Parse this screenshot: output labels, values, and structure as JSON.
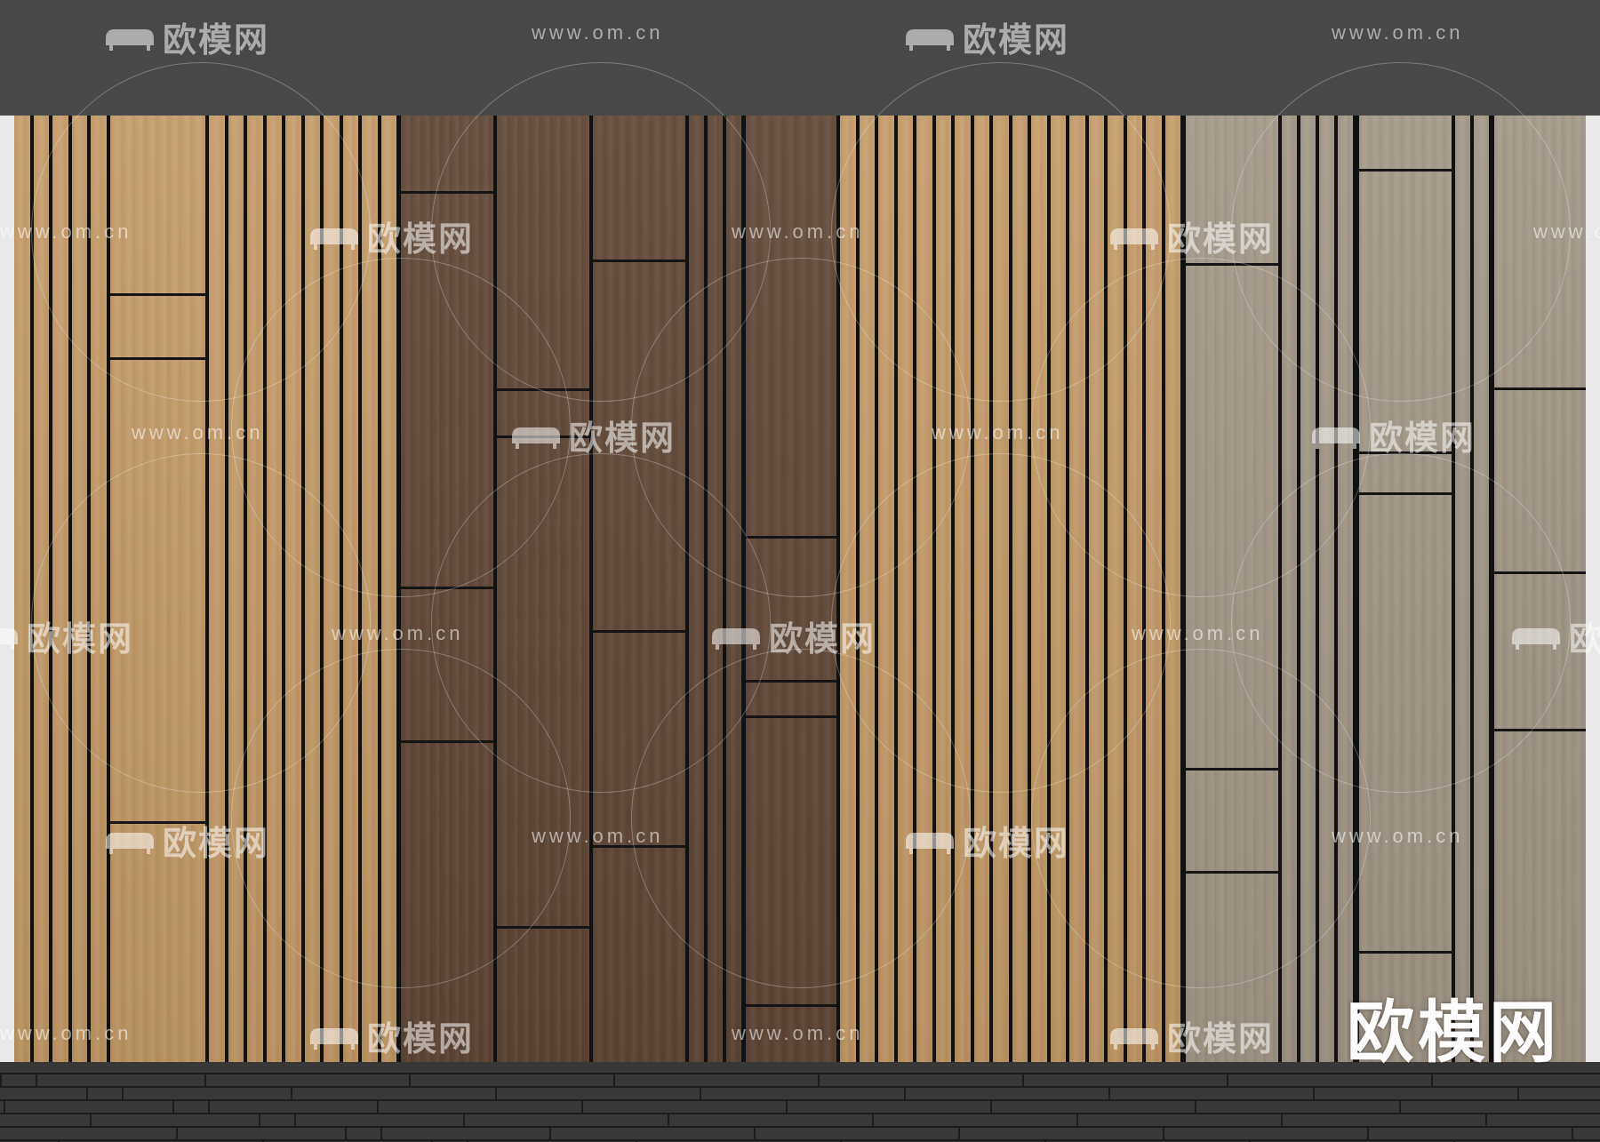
{
  "colors": {
    "ceiling": "#484848",
    "light_oak": "#c49a66",
    "dark_walnut": "#5e4636",
    "grey_oak": "#a19686",
    "gap": "#111111",
    "floor": "#383838"
  },
  "watermarks": {
    "logo_text": "欧模网",
    "url_text": "www.om.cn"
  },
  "brand": {
    "text": "欧模网"
  }
}
